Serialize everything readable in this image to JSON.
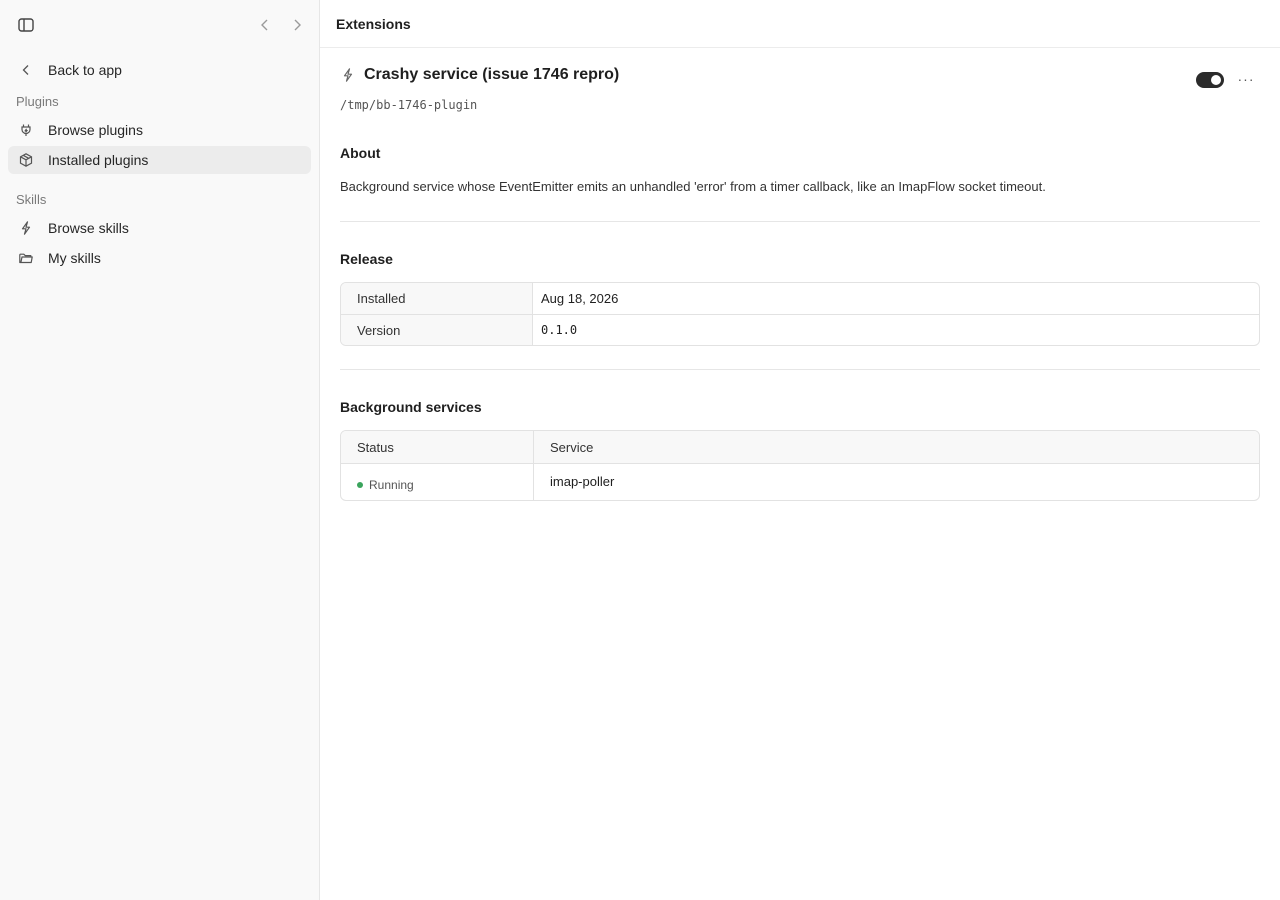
{
  "header": {
    "title": "Extensions"
  },
  "sidebar": {
    "back_label": "Back to app",
    "plugins_section": "Plugins",
    "skills_section": "Skills",
    "items": [
      {
        "label": "Browse plugins",
        "icon": "plug-icon"
      },
      {
        "label": "Installed plugins",
        "icon": "package-icon",
        "active": true
      },
      {
        "label": "Browse skills",
        "icon": "bolt-icon"
      },
      {
        "label": "My skills",
        "icon": "folder-icon"
      }
    ]
  },
  "plugin": {
    "name": "Crashy service (issue 1746 repro)",
    "path": "/tmp/bb-1746-plugin",
    "enabled": true,
    "more_label": "···"
  },
  "about": {
    "title": "About",
    "text": "Background service whose EventEmitter emits an unhandled 'error' from a timer callback, like an ImapFlow socket timeout."
  },
  "release": {
    "title": "Release",
    "rows": [
      {
        "key": "Installed",
        "value": "Aug 18, 2026"
      },
      {
        "key": "Version",
        "value": "0.1.0"
      }
    ]
  },
  "services": {
    "title": "Background services",
    "col_status": "Status",
    "col_service": "Service",
    "rows": [
      {
        "status": "Running",
        "service": "imap-poller",
        "status_color": "#3aa45c"
      }
    ]
  }
}
